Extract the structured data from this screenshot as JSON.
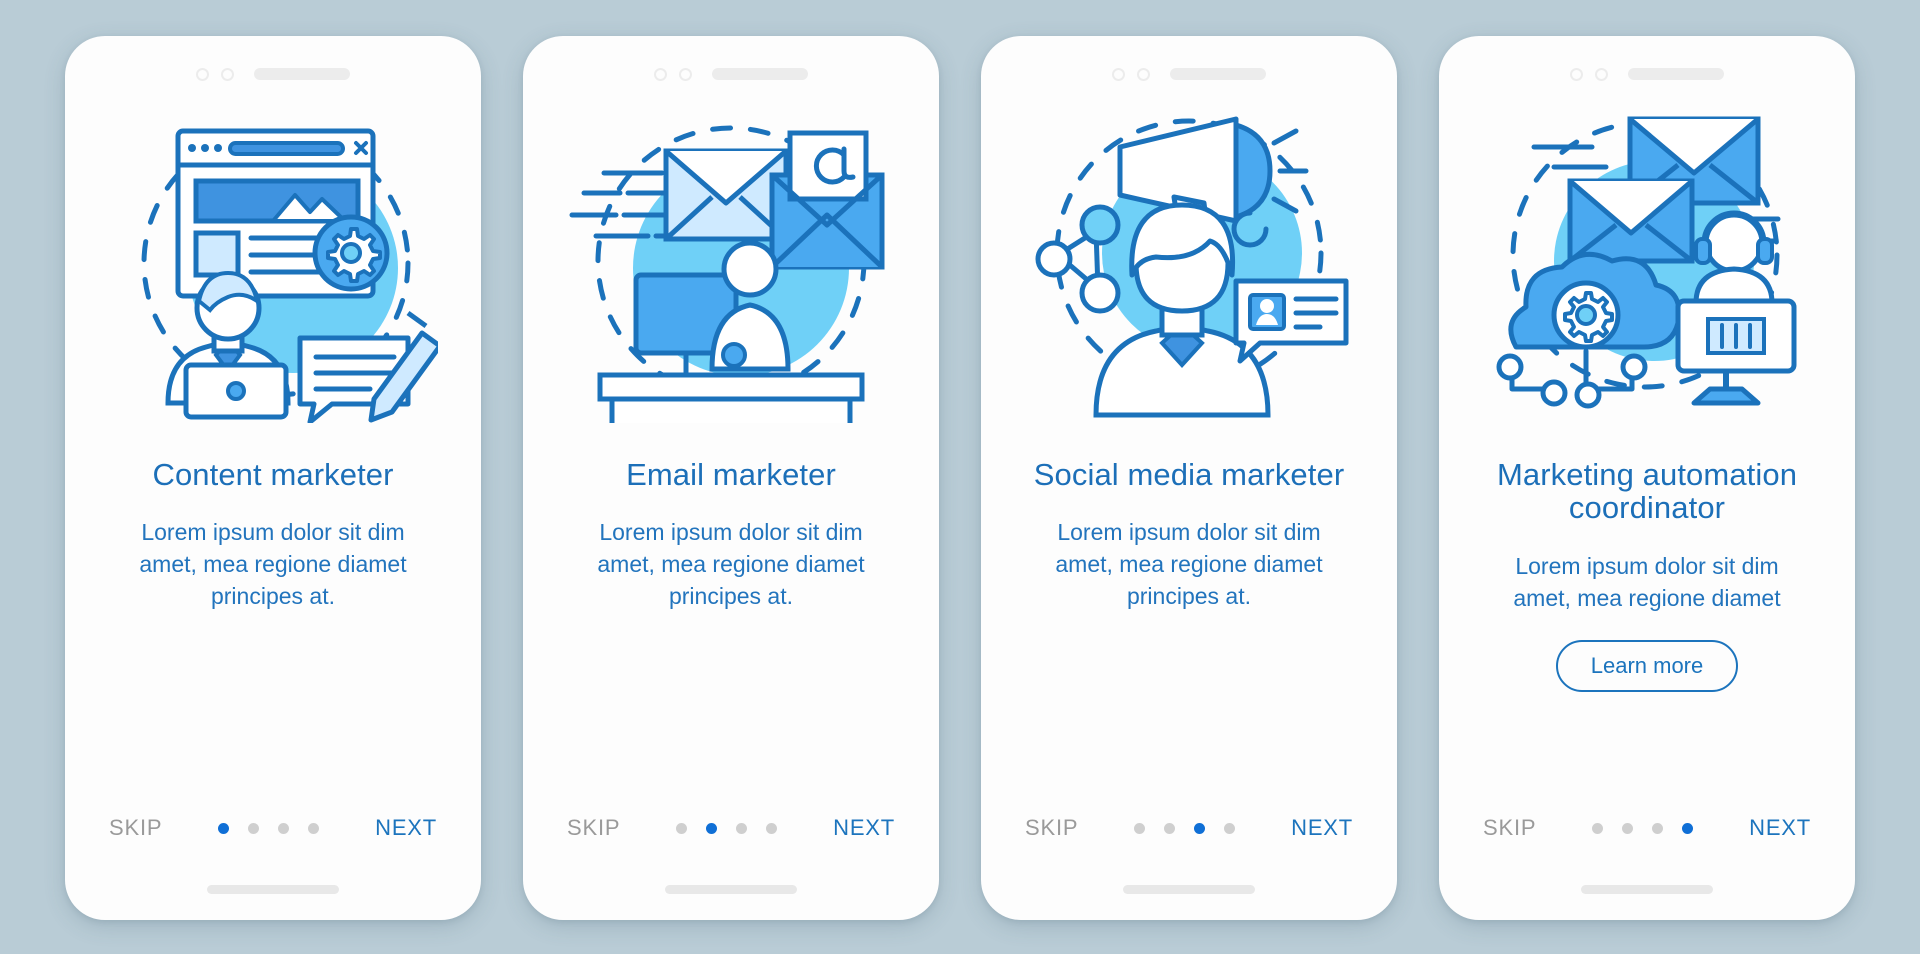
{
  "theme": {
    "background": "#b9ccd6",
    "card_bg": "#fdfdfd",
    "title_color": "#1c6fb8",
    "desc_color": "#2274bd",
    "accent": "#1c74bd",
    "dot_active": "#0f6fd6",
    "dot_inactive": "#cfcfcf",
    "skip_color": "#9a9a9a",
    "illustration_line": "#1b72bb",
    "illustration_fill_light": "#cfeaff",
    "illustration_fill_mid": "#4aa9f0",
    "illustration_circle": "#6fd0f7"
  },
  "screens": [
    {
      "id": "content-marketer",
      "illustration_name": "content-marketer-illustration",
      "title": "Content marketer",
      "description": "Lorem ipsum dolor sit dim amet, mea regione diamet principes at.",
      "skip_label": "SKIP",
      "next_label": "NEXT",
      "dots": 4,
      "active_dot": 1,
      "has_button": false,
      "button_label": ""
    },
    {
      "id": "email-marketer",
      "illustration_name": "email-marketer-illustration",
      "title": "Email marketer",
      "description": "Lorem ipsum dolor sit dim amet, mea regione diamet principes at.",
      "skip_label": "SKIP",
      "next_label": "NEXT",
      "dots": 4,
      "active_dot": 2,
      "has_button": false,
      "button_label": ""
    },
    {
      "id": "social-media-marketer",
      "illustration_name": "social-media-marketer-illustration",
      "title": "Social media marketer",
      "description": "Lorem ipsum dolor sit dim amet, mea regione diamet principes at.",
      "skip_label": "SKIP",
      "next_label": "NEXT",
      "dots": 4,
      "active_dot": 3,
      "has_button": false,
      "button_label": ""
    },
    {
      "id": "marketing-automation-coordinator",
      "illustration_name": "marketing-automation-illustration",
      "title": "Marketing automation coordinator",
      "description": "Lorem ipsum dolor sit dim amet, mea regione diamet",
      "skip_label": "SKIP",
      "next_label": "NEXT",
      "dots": 4,
      "active_dot": 4,
      "has_button": true,
      "button_label": "Learn more"
    }
  ]
}
